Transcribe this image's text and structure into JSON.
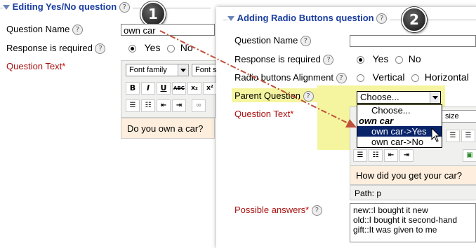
{
  "panel1": {
    "legend": "Editing Yes/No question",
    "badge": "1",
    "question_name_label": "Question Name",
    "question_name_value": "own car",
    "response_required_label": "Response is required",
    "yes_label": "Yes",
    "no_label": "No",
    "question_text_label": "Question Text",
    "required_star": "*",
    "font_family_label": "Font family",
    "font_size_label": "Font s",
    "editor_text": "Do you own a car?"
  },
  "panel2": {
    "legend": "Adding Radio Buttons question",
    "badge": "2",
    "question_name_label": "Question Name",
    "response_required_label": "Response is required",
    "yes_label": "Yes",
    "no_label": "No",
    "alignment_label": "Radio buttons Alignment",
    "vertical_label": "Vertical",
    "horizontal_label": "Horizontal",
    "parent_question_label": "Parent Question",
    "parent_select_value": "Choose...",
    "dropdown": {
      "choose": "Choose...",
      "group": "own car",
      "opt_yes": "own car->Yes",
      "opt_no": "own car->No"
    },
    "question_text_label": "Question Text",
    "required_star": "*",
    "font_size_fragment": "size",
    "editor_text": "How did you get your car?",
    "path_text": "Path: p",
    "possible_answers_label": "Possible answers",
    "possible_answers_value": "new::I bought it new\nold::I bought it second-hand\ngift::It was given to me"
  },
  "help_glyph": "?",
  "colors": {
    "legend": "#1a3da0",
    "label_red": "#a11",
    "highlight": "#f5f5a0",
    "arrow": "#c0503a",
    "selected_option": "#0a246a"
  }
}
